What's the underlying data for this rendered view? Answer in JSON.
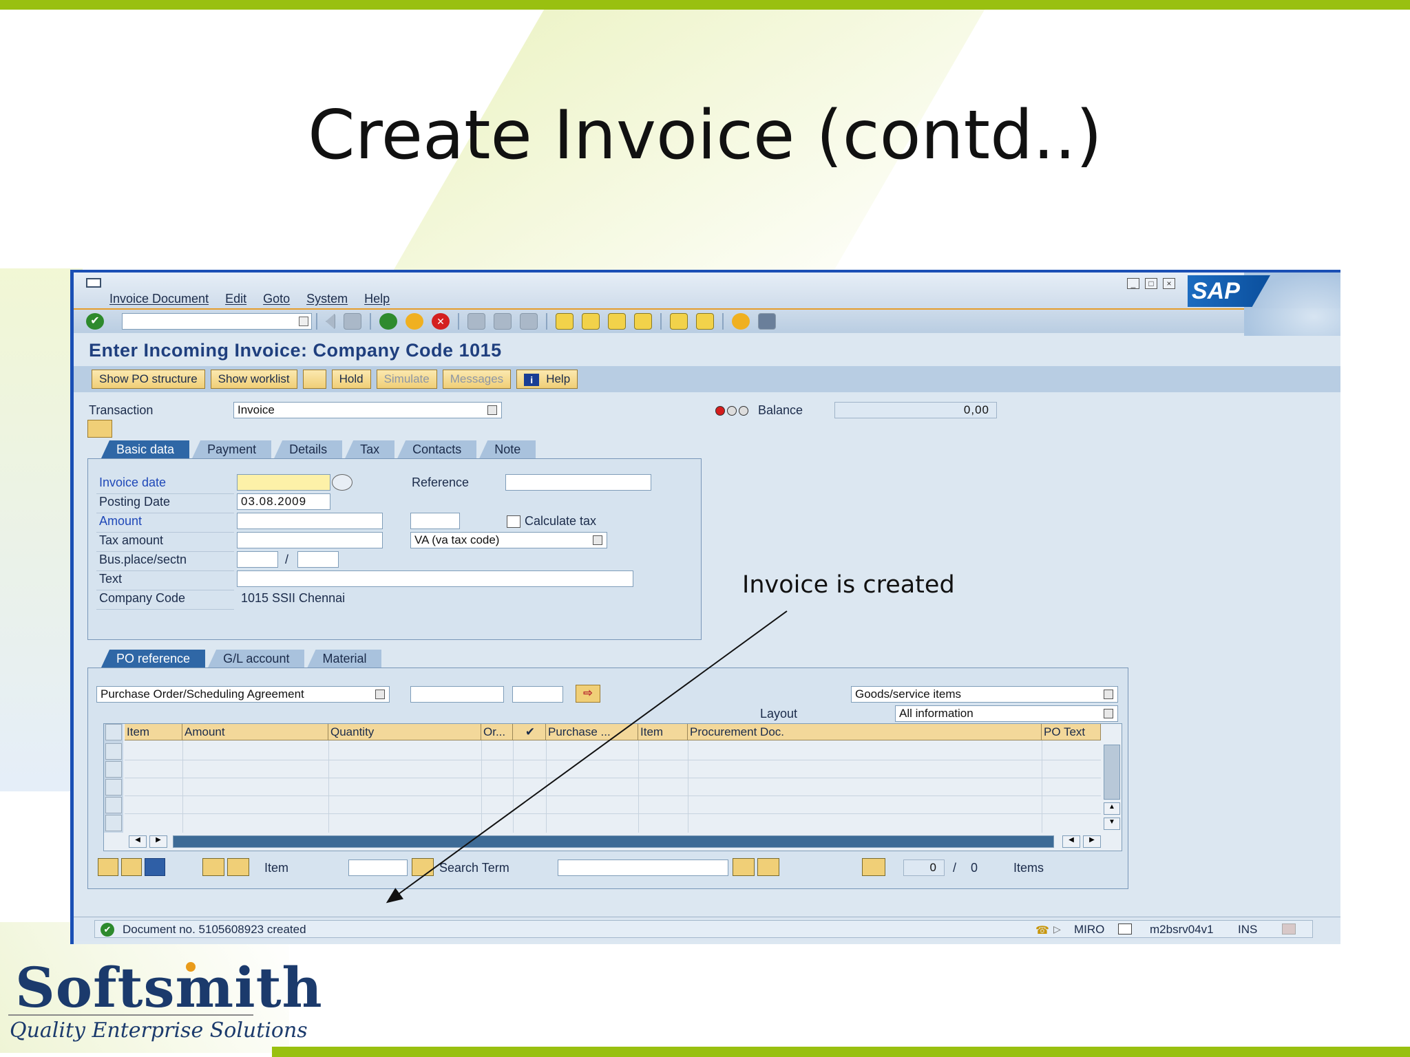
{
  "slide": {
    "title": "Create Invoice (contd..)",
    "annotation": "Invoice is created",
    "logo_name": "Softsmith",
    "logo_tagline": "Quality Enterprise Solutions"
  },
  "sap": {
    "brand": "SAP",
    "menu": [
      "Invoice Document",
      "Edit",
      "Goto",
      "System",
      "Help"
    ],
    "screen_title": "Enter Incoming Invoice: Company Code 1015",
    "app_buttons": {
      "show_po": "Show PO structure",
      "show_worklist": "Show worklist",
      "hold": "Hold",
      "simulate": "Simulate",
      "messages": "Messages",
      "help": "Help"
    },
    "transaction": {
      "label": "Transaction",
      "value": "Invoice"
    },
    "balance": {
      "label": "Balance",
      "value": "0,00"
    },
    "tabs": [
      "Basic data",
      "Payment",
      "Details",
      "Tax",
      "Contacts",
      "Note"
    ],
    "basic": {
      "invoice_date_label": "Invoice date",
      "posting_date_label": "Posting Date",
      "posting_date_value": "03.08.2009",
      "amount_label": "Amount",
      "tax_amount_label": "Tax amount",
      "bus_place_label": "Bus.place/sectn",
      "slash": "/",
      "text_label": "Text",
      "company_code_label": "Company Code",
      "company_code_value": "1015 SSII Chennai",
      "reference_label": "Reference",
      "calculate_tax_label": "Calculate tax",
      "tax_code_value": "VA (va tax code)"
    },
    "lower_tabs": [
      "PO reference",
      "G/L account",
      "Material"
    ],
    "po": {
      "doc_type": "Purchase Order/Scheduling Agreement",
      "items_select": "Goods/service items",
      "layout_label": "Layout",
      "layout_value": "All information"
    },
    "grid_columns": [
      "Item",
      "Amount",
      "Quantity",
      "Or...",
      "",
      "Purchase ...",
      "Item",
      "Procurement Doc.",
      "PO Text"
    ],
    "grid_bottom": {
      "item_label": "Item",
      "search_label": "Search Term",
      "count_current": "0",
      "count_sep": "/",
      "count_total": "0",
      "items_label": "Items"
    },
    "status": {
      "message": "Document no. 5105608923 created",
      "tcode": "MIRO",
      "server": "m2bsrv04v1",
      "mode": "INS"
    }
  }
}
